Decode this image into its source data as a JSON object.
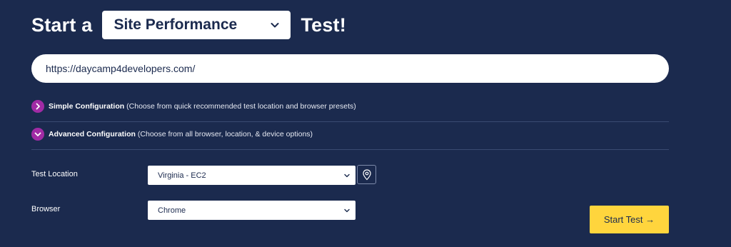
{
  "heading": {
    "prefix": "Start a",
    "suffix": "Test!",
    "test_type_selected": "Site Performance"
  },
  "url_input": {
    "value": "https://daycamp4developers.com/"
  },
  "simple_config": {
    "label": "Simple Configuration",
    "description": "(Choose from quick recommended test location and browser presets)",
    "icon": "chevron-right-icon"
  },
  "advanced_config": {
    "label": "Advanced Configuration",
    "description": "(Choose from all browser, location, & device options)",
    "icon": "chevron-down-icon"
  },
  "test_location": {
    "label": "Test Location",
    "selected": "Virginia - EC2",
    "map_icon": "map-pin-icon"
  },
  "browser": {
    "label": "Browser",
    "selected": "Chrome"
  },
  "start_button": {
    "label": "Start Test →"
  },
  "colors": {
    "background": "#1b2a4e",
    "toggle_accent": "#a12ba5",
    "start_button": "#ffd53d"
  }
}
